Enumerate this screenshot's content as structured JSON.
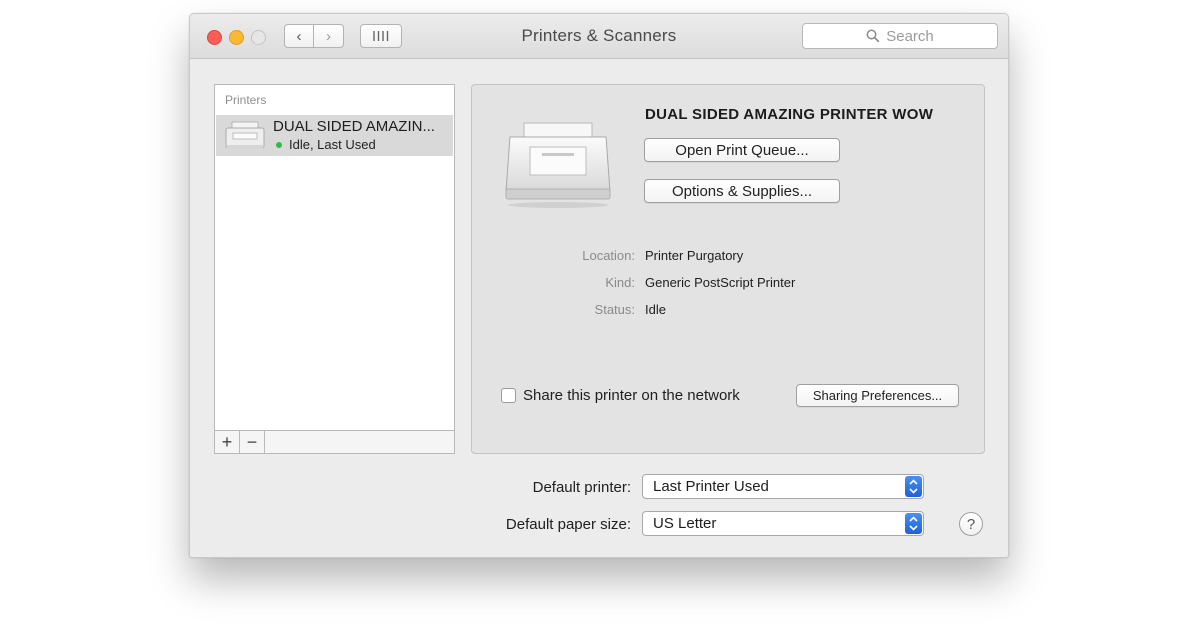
{
  "window": {
    "title": "Printers & Scanners",
    "search_placeholder": "Search",
    "nav": {
      "back_glyph": "‹",
      "forward_glyph": "›",
      "grid_glyph": "⁞⁞⁞⁞"
    }
  },
  "printers_list": {
    "header": "Printers",
    "items": [
      {
        "name": "DUAL SIDED AMAZIN...",
        "status": "Idle, Last Used",
        "status_color": "#35b84a",
        "icon": "printer-icon"
      }
    ],
    "add_label": "+",
    "remove_label": "−"
  },
  "detail": {
    "printer_name": "DUAL SIDED AMAZING PRINTER WOW",
    "open_queue_label": "Open Print Queue...",
    "options_label": "Options & Supplies...",
    "location_label": "Location:",
    "location_value": "Printer Purgatory",
    "kind_label": "Kind:",
    "kind_value": "Generic PostScript Printer",
    "status_label": "Status:",
    "status_value": "Idle",
    "share_label": "Share this printer on the network",
    "share_checked": false,
    "sharing_prefs_label": "Sharing Preferences..."
  },
  "defaults": {
    "default_printer_label": "Default printer:",
    "default_printer_value": "Last Printer Used",
    "paper_size_label": "Default paper size:",
    "paper_size_value": "US Letter"
  },
  "help_label": "?",
  "colors": {
    "close": "#fb5c55",
    "minimize": "#fcb833",
    "accent": "#1e62d6"
  }
}
